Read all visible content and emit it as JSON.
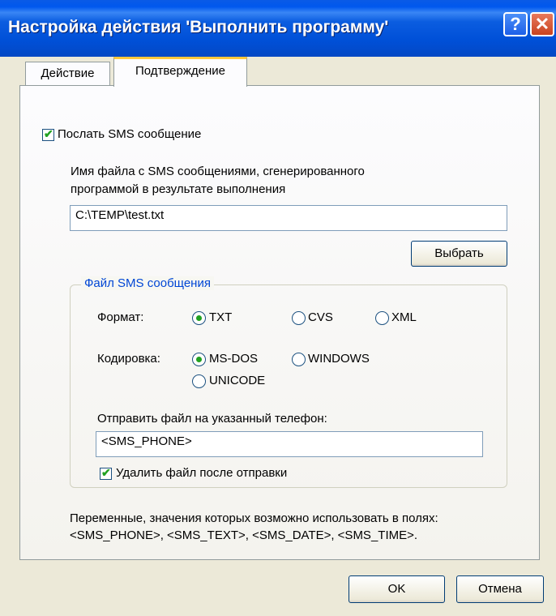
{
  "window": {
    "title": "Настройка действия 'Выполнить программу'",
    "help_label": "?",
    "close_label": "✕"
  },
  "tabs": [
    {
      "label": "Действие",
      "selected": false
    },
    {
      "label": "Подтверждение",
      "selected": true
    }
  ],
  "send_sms": {
    "label": "Послать SMS сообщение",
    "checked": true
  },
  "file_prompt": {
    "line1": "Имя файла с SMS сообщениями, сгенерированного",
    "line2": "программой в результате выполнения"
  },
  "file_path": {
    "value": "C:\\TEMP\\test.txt"
  },
  "browse_button": {
    "label": "Выбрать"
  },
  "sms_file_group": {
    "title": "Файл SMS сообщения",
    "format_label": "Формат:",
    "format_options": [
      {
        "label": "TXT",
        "selected": true
      },
      {
        "label": "CVS",
        "selected": false
      },
      {
        "label": "XML",
        "selected": false
      }
    ],
    "encoding_label": "Кодировка:",
    "encoding_options": [
      {
        "label": "MS-DOS",
        "selected": true
      },
      {
        "label": "WINDOWS",
        "selected": false
      },
      {
        "label": "UNICODE",
        "selected": false
      }
    ],
    "phone_label": "Отправить файл на указанный телефон:",
    "phone_value": "<SMS_PHONE>",
    "delete_after": {
      "label": "Удалить файл после отправки",
      "checked": true
    }
  },
  "variables_note": {
    "line1": "Переменные, значения которых возможно использовать в полях:",
    "line2": "<SMS_PHONE>, <SMS_TEXT>, <SMS_DATE>, <SMS_TIME>."
  },
  "ok_button": {
    "label": "OK"
  },
  "cancel_button": {
    "label": "Отмена"
  }
}
